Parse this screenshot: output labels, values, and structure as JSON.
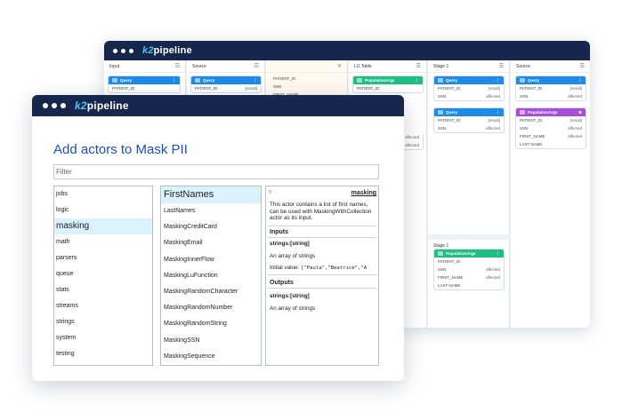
{
  "app": {
    "brand_prefix": "k2",
    "brand_suffix": "pipeline"
  },
  "back": {
    "columns": [
      {
        "title": "Input"
      },
      {
        "title": "Source"
      },
      {
        "title": ""
      },
      {
        "title": "LU Table"
      },
      {
        "title": "Stage 1"
      },
      {
        "title": "Source"
      }
    ],
    "popup_rows": [
      "PATIENT_ID",
      "SSN",
      "FIRST_NAME",
      "LAST NAME"
    ],
    "query_label": "Query",
    "population_label": "PopulationArgs",
    "row_patient_id": "PATIENT_ID",
    "row_ssn": "SSN",
    "row_first_name": "FIRST_NAME",
    "row_last_name": "LAST NAME",
    "val_result": "[result]",
    "val_affected": "affected",
    "stage1_lower": "Stage 1"
  },
  "front": {
    "title": "Add actors to Mask PII",
    "filter_placeholder": "Filter",
    "categories": [
      "jobs",
      "logic",
      "masking",
      "math",
      "parsers",
      "queue",
      "stats",
      "streams",
      "strings",
      "system",
      "testing"
    ],
    "selected_category": "masking",
    "actors": [
      "FirstNames",
      "LastNames",
      "MaskingCreditCard",
      "MaskingEmail",
      "MaskingInnerFlow",
      "MaskingLuFunction",
      "MaskingRandomCharacter",
      "MaskingRandomNumber",
      "MaskingRandomString",
      "MaskingSSN",
      "MaskingSequence"
    ],
    "selected_actor": "FirstNames",
    "detail": {
      "category": "masking",
      "description": "This actor contains a list of first names, can be used with MaskingWithCollection actor as its input.",
      "inputs_title": "Inputs",
      "input_sig": "strings:[string]",
      "input_desc": "An array of strings",
      "initial_label": "Initial value:",
      "initial_value": "[\"Paula\",\"Beatrice\",\"A",
      "outputs_title": "Outputs",
      "output_sig": "strings:[string]",
      "output_desc": "An array of strings"
    }
  },
  "colors": {
    "title_blue": "#1b4fbf",
    "nav": "#16264d",
    "selected_bg": "#d9f2fb",
    "head_blue": "#1f8be8",
    "head_green": "#1fbf83",
    "head_purple": "#a64fd6"
  }
}
